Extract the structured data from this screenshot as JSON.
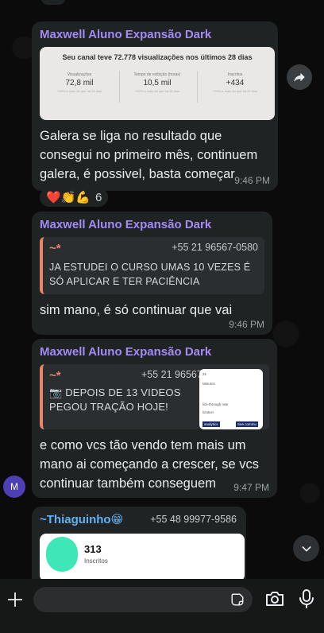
{
  "messages": [
    {
      "sender": "Maxwell Aluno Expansão Dark",
      "image": {
        "title": "Seu canal teve 72.778 visualizações nos últimos 28 dias",
        "stats": [
          {
            "label": "Visualizações",
            "value": "72,8 mil",
            "sub": "+99% a mais do que há 28 dias"
          },
          {
            "label": "Tempo de exibição (horas)",
            "value": "10,5 mil",
            "sub": "+99% a mais do que há 28 dias"
          },
          {
            "label": "Inscritos",
            "value": "+434",
            "sub": "+99% a mais do que há 28 dias"
          }
        ]
      },
      "text": "Galera se liga no resultado que consegui no primeiro mês, continuem galera, é possivel, basta começar",
      "time": "9:46 PM",
      "reactions": {
        "emojis": "❤️👏💪",
        "count": "6"
      }
    },
    {
      "sender": "Maxwell Aluno Expansão Dark",
      "quote": {
        "name": "~*",
        "phone": "+55 21 96567-0580",
        "text": "JA ESTUDEI O CURSO UMAS 10 VEZES É SÓ APLICAR  E TER PACIÊNCIA"
      },
      "text": "sim  mano, é só continuar que vai",
      "time": "9:46 PM"
    },
    {
      "sender": "Maxwell Aluno Expansão Dark",
      "quote": {
        "name": "~*",
        "phone": "+55 21 96567-0580",
        "text": "📷 DEPOIS DE 13 VIDEOS PEGOU TRAÇÃO HOJE!"
      },
      "thumb_lines": [
        "31",
        "Minutos",
        "lick-through rate",
        "lization",
        "analytics",
        "See commu"
      ],
      "text": "e como vcs tão vendo tem mais um mano ai começando a crescer, se vcs continuar também conseguem",
      "time": "9:47 PM",
      "avatar": "M"
    },
    {
      "sender": "~Thiaguinho😁",
      "phone": "+55 48 99977-9586",
      "card": {
        "count": "313",
        "label": "Inscritos"
      }
    }
  ],
  "colors": {
    "sender": "#a48bf3",
    "quote_accent": "#e8856b",
    "bubble": "#202324",
    "background": "#0b0b0b"
  },
  "icons": [
    "forward-icon",
    "chevron-down-icon",
    "plus-icon",
    "sticker-icon",
    "camera-icon",
    "microphone-icon"
  ]
}
